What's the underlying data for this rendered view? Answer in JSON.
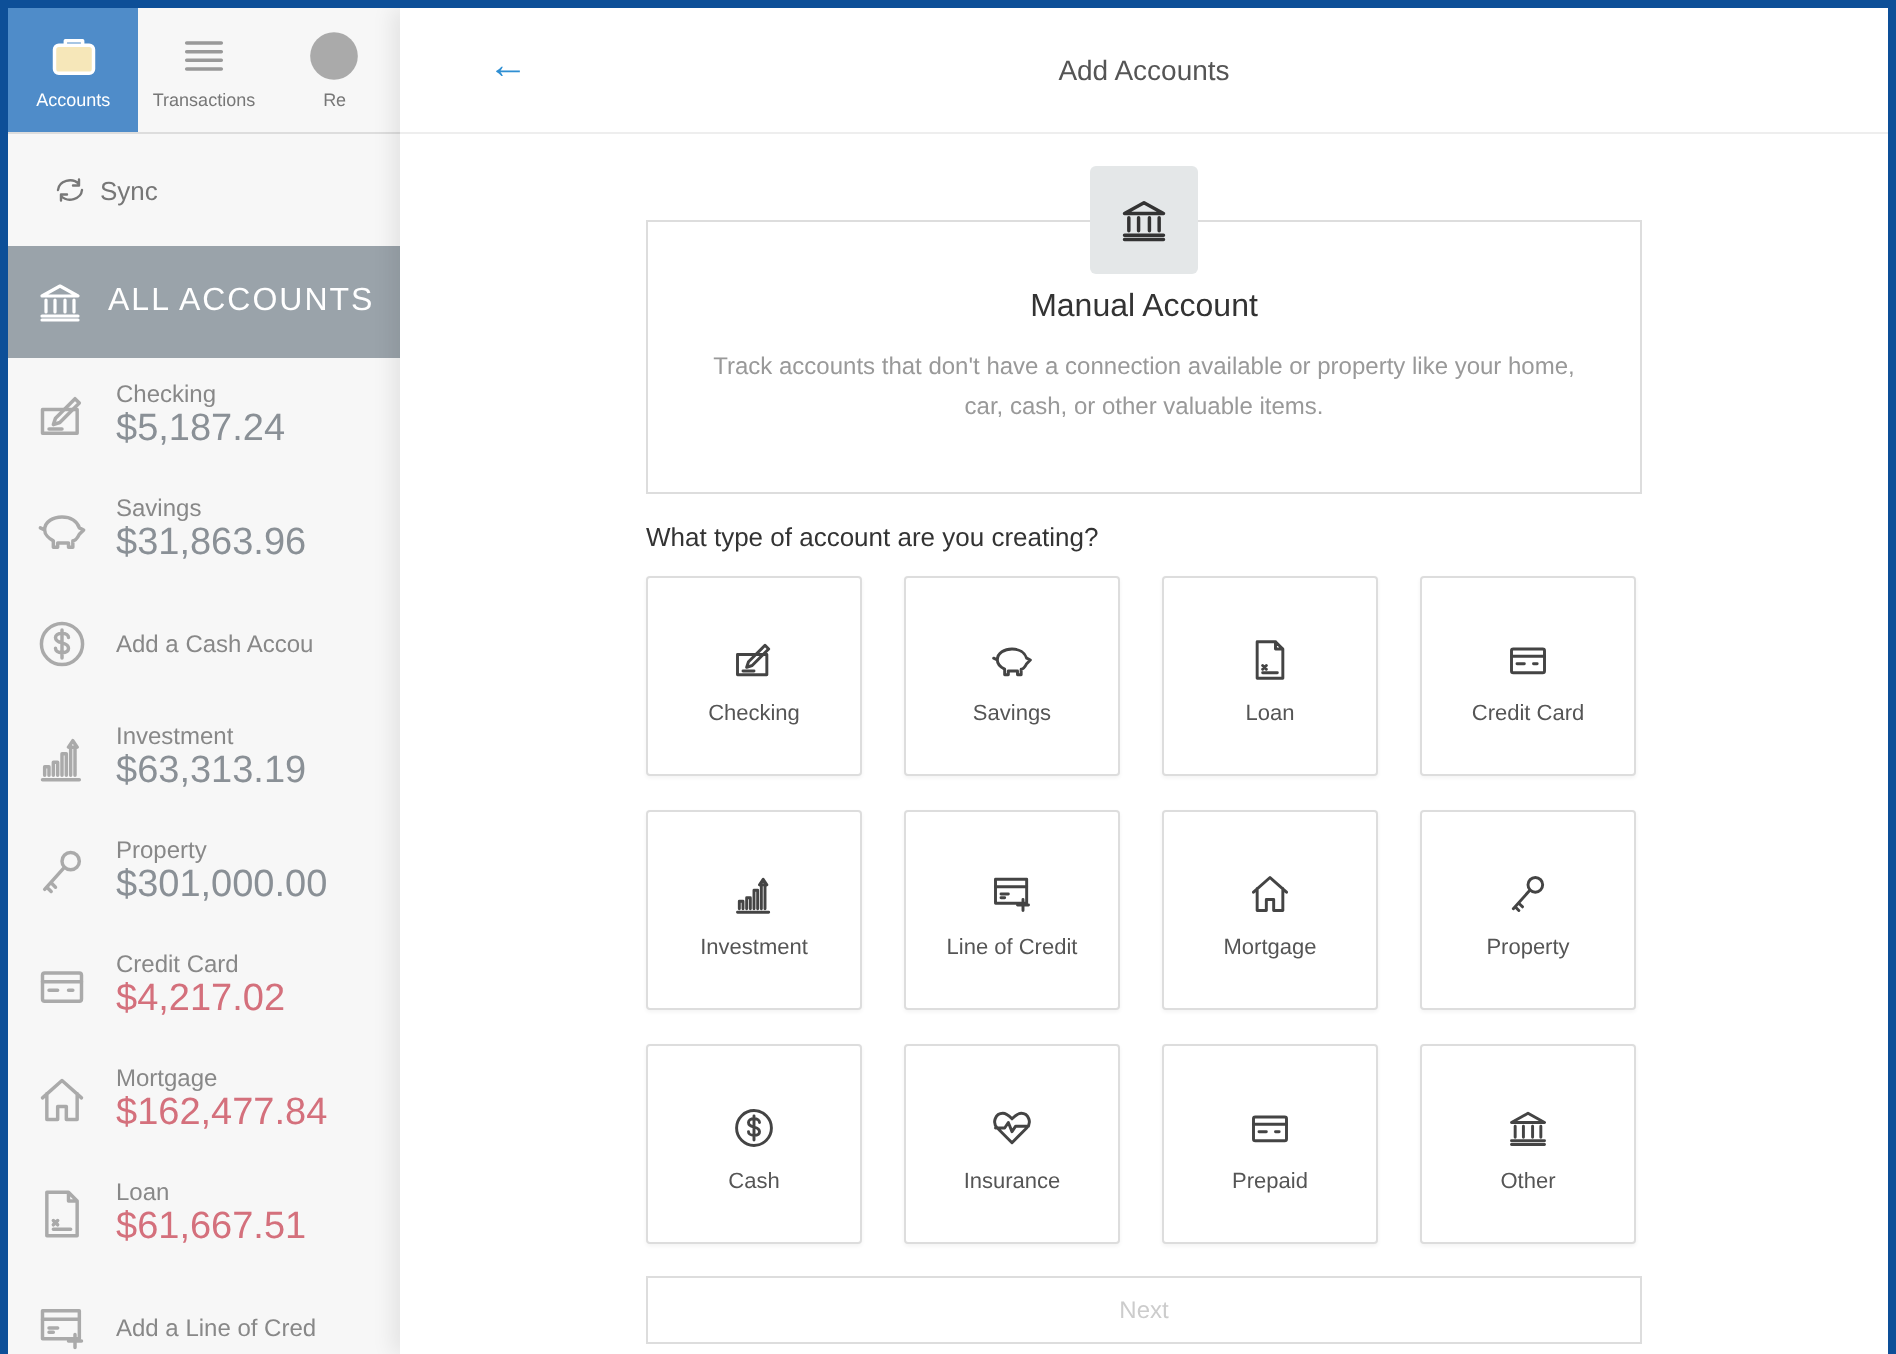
{
  "sidebar": {
    "tabs": [
      {
        "label": "Accounts",
        "selected": true
      },
      {
        "label": "Transactions",
        "selected": false
      },
      {
        "label": "Re",
        "selected": false
      }
    ],
    "sync": {
      "label": "Sync"
    },
    "all_accounts": {
      "label": "ALL ACCOUNTS"
    },
    "items": [
      {
        "kind": "account",
        "label": "Checking",
        "amount": "$5,187.24",
        "color": "#8a9096"
      },
      {
        "kind": "account",
        "label": "Savings",
        "amount": "$31,863.96",
        "color": "#8a9096"
      },
      {
        "kind": "add",
        "label": "Add a Cash Accou"
      },
      {
        "kind": "account",
        "label": "Investment",
        "amount": "$63,313.19",
        "color": "#8a9096"
      },
      {
        "kind": "account",
        "label": "Property",
        "amount": "$301,000.00",
        "color": "#8a9096"
      },
      {
        "kind": "account",
        "label": "Credit Card",
        "amount": "$4,217.02",
        "color": "#d4707c"
      },
      {
        "kind": "account",
        "label": "Mortgage",
        "amount": "$162,477.84",
        "color": "#d4707c"
      },
      {
        "kind": "account",
        "label": "Loan",
        "amount": "$61,667.51",
        "color": "#d4707c"
      },
      {
        "kind": "add",
        "label": "Add a Line of Cred"
      }
    ]
  },
  "modal": {
    "back": "←",
    "title": "Add Accounts",
    "manual": {
      "title": "Manual Account",
      "description": "Track accounts that don't have a connection available or property like your home, car, cash, or other valuable items."
    },
    "question": "What type of account are you creating?",
    "types": [
      {
        "label": "Checking"
      },
      {
        "label": "Savings"
      },
      {
        "label": "Loan"
      },
      {
        "label": "Credit Card"
      },
      {
        "label": "Investment"
      },
      {
        "label": "Line of Credit"
      },
      {
        "label": "Mortgage"
      },
      {
        "label": "Property"
      },
      {
        "label": "Cash"
      },
      {
        "label": "Insurance"
      },
      {
        "label": "Prepaid"
      },
      {
        "label": "Other"
      }
    ],
    "next": {
      "label": "Next",
      "disabled": true
    }
  }
}
